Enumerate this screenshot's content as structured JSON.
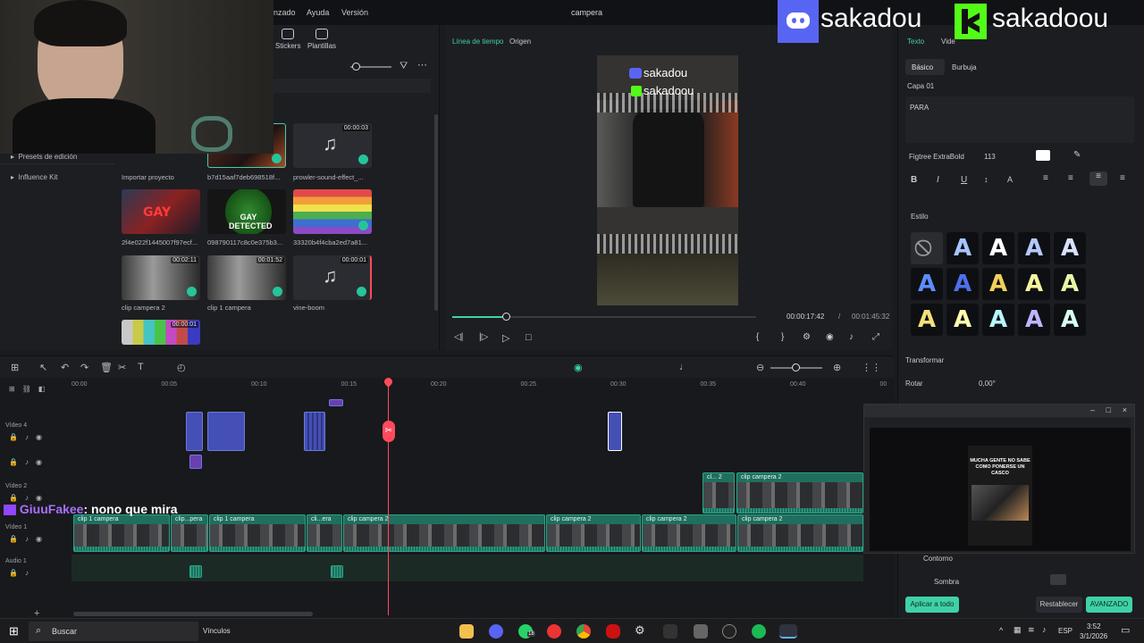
{
  "window": {
    "title": "campera"
  },
  "menu": {
    "items": [
      "nzado",
      "Ayuda",
      "Versión"
    ]
  },
  "media_toolbar": {
    "stickers": "Stickers",
    "plantillas": "Plantillas"
  },
  "sidebar": {
    "items": [
      "Presets de edición",
      "Influence Kit"
    ]
  },
  "media": {
    "import_label": "Importar proyecto",
    "items": [
      {
        "name": "b7d15aaf7deb698518f...",
        "duration": ""
      },
      {
        "name": "prowler-sound-effect_...",
        "duration": "00:00:03"
      },
      {
        "name": "2f4e022f1445007f97ecf...",
        "duration": "",
        "overlay": "GAY"
      },
      {
        "name": "098790117c8c0e375b3...",
        "duration": "",
        "overlay": "GAY DETECTED"
      },
      {
        "name": "33320b4f4cba2ed7a81...",
        "duration": ""
      },
      {
        "name": "clip campera 2",
        "duration": "00:02:11"
      },
      {
        "name": "clip 1 campera",
        "duration": "00:01:52"
      },
      {
        "name": "vine-boom",
        "duration": "00:00:01"
      },
      {
        "name": "",
        "duration": "00:00:01"
      }
    ]
  },
  "preview": {
    "tabs": [
      "Línea de tiempo",
      "Origen"
    ],
    "current_time": "00:00:17:42",
    "separator": "/",
    "total_time": "00:01:45:32",
    "overlay_line1": "sakadou",
    "overlay_line2": "sakadoou"
  },
  "inspector": {
    "tab_texto": "Texto",
    "tab_video": "Vide",
    "subtabs": [
      "Básico",
      "Burbuja"
    ],
    "layer": "Capa 01",
    "text_value": "PARA",
    "font": "Figtree ExtraBold",
    "font_size": "113",
    "style_label": "Estilo",
    "transform_label": "Transformar",
    "rotate_label": "Rotar",
    "rotate_value": "0,00°",
    "outline_label": "Contorno",
    "shadow_label": "Sombra",
    "apply_all": "Aplicar a todo",
    "reset": "Restablecer",
    "advanced": "AVANZADO",
    "colors": {
      "accent": "#3fd1a7",
      "style_blue": "#5e8cff",
      "style_yellow": "#f2d15a"
    }
  },
  "timeline": {
    "ticks": [
      "00:00",
      "00:05",
      "00:10",
      "00:15",
      "00:20",
      "00:25",
      "00:30",
      "00:35",
      "00:40",
      "00"
    ],
    "tracks": [
      "Vídeo 4",
      "Vídeo 2",
      "Vídeo 1",
      "Audio 1"
    ],
    "clips_video1": [
      "clip 1 campera",
      "clip...pera",
      "clip 1 campera",
      "cli...era",
      "clip campera 2",
      "clip campera 2",
      "clip campera 2",
      "clip campera 2"
    ],
    "clips_video2": [
      "cl... 2",
      "clip campera 2"
    ]
  },
  "overlay": {
    "discord_name": "sakadou",
    "kick_name": "sakadoou",
    "chat_user": "GiuuFakee",
    "chat_message": ": nono que mira",
    "mini_caption": "MUCHA GENTE NO SABE COMO PONERSE UN CASCO"
  },
  "taskbar": {
    "search": "Buscar",
    "links": "Vínculos",
    "lang": "ESP",
    "time": "3:52",
    "date": "3/1/2026",
    "badge": "18"
  }
}
